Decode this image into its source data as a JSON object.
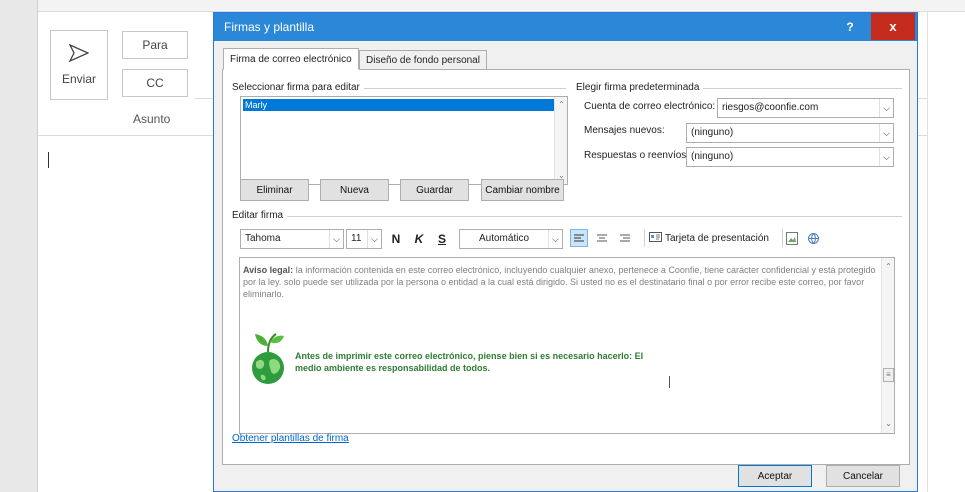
{
  "compose": {
    "send_label": "Enviar",
    "to_label": "Para",
    "cc_label": "CC",
    "subject_label": "Asunto"
  },
  "dialog": {
    "title": "Firmas y plantilla",
    "help": "?",
    "close": "x",
    "tabs": [
      "Firma de correo electrónico",
      "Diseño de fondo personal"
    ],
    "select_group": "Seleccionar firma para editar",
    "signatures": [
      "Marly"
    ],
    "buttons": {
      "delete": "Eliminar",
      "new": "Nueva",
      "save": "Guardar",
      "rename": "Cambiar nombre",
      "accept": "Aceptar",
      "cancel": "Cancelar"
    },
    "default_group": "Elegir firma predeterminada",
    "account_label": "Cuenta de correo electrónico:",
    "account_value": "riesgos@coonfie.com",
    "new_messages_label": "Mensajes nuevos:",
    "new_messages_value": "(ninguno)",
    "replies_label": "Respuestas o reenvíos:",
    "replies_value": "(ninguno)",
    "edit_group": "Editar firma",
    "toolbar": {
      "font": "Tahoma",
      "size": "11",
      "bold": "N",
      "italic": "K",
      "strike": "S",
      "color": "Automático",
      "business_card": "Tarjeta de presentación"
    },
    "editor": {
      "legal_prefix": "Aviso legal:",
      "legal_text": " la información contenida en este correo electrónico, incluyendo cualquier anexo, pertenece a Coonfie, tiene carácter confidencial y está protegido por la ley. solo puede ser utilizada por la persona o entidad a la cual está dirigido. Si usted no es el destinatario final o por error recibe este correo, por favor eliminarlo.",
      "green_line1": "Antes de imprimir este correo electrónico, piense bien si es necesario hacerlo: El",
      "green_line2": "medio ambiente es responsabilidad de todos."
    },
    "templates_link": "Obtener plantillas de firma"
  },
  "colors": {
    "titlebar": "#2b88d8",
    "close": "#c42b1c",
    "selection": "#0078d7",
    "eco_green": "#2e7d32"
  }
}
